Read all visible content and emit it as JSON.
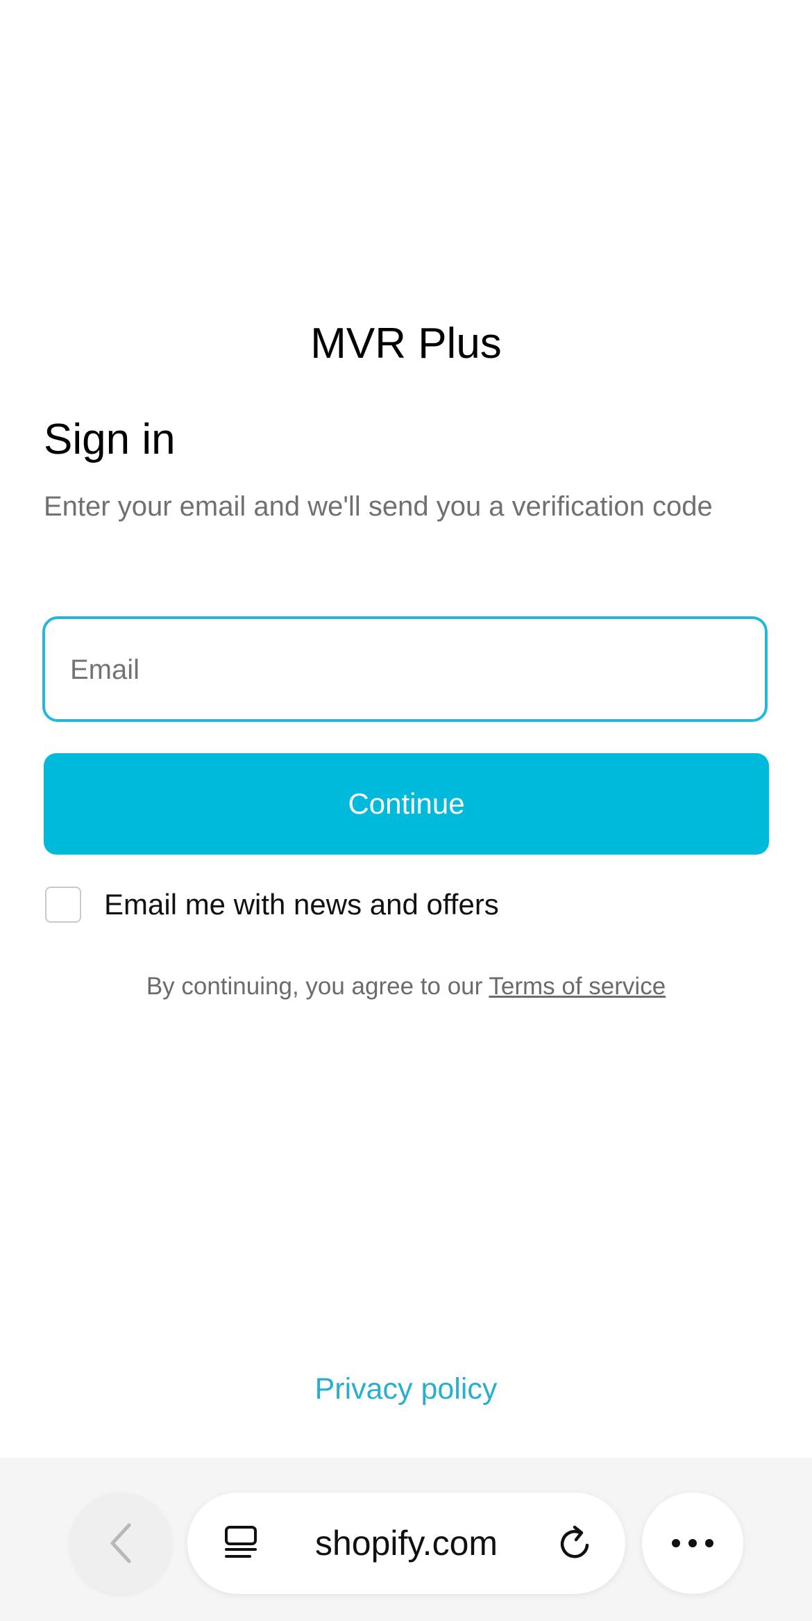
{
  "shop": {
    "name": "MVR Plus"
  },
  "signin": {
    "heading": "Sign in",
    "subtitle": "Enter your email and we'll send you a verification code",
    "email_placeholder": "Email",
    "email_value": "",
    "continue_label": "Continue",
    "newsletter_label": "Email me with news and offers",
    "newsletter_checked": false,
    "terms_prefix": "By continuing, you agree to our ",
    "terms_link": "Terms of service"
  },
  "footer": {
    "privacy_link": "Privacy policy"
  },
  "browser": {
    "url": "shopify.com",
    "icons": {
      "back": "chevron-left-icon",
      "tabs": "tabs-icon",
      "reload": "reload-icon",
      "more": "more-icon"
    }
  },
  "colors": {
    "accent": "#00badb",
    "focus_border": "#22b8d9",
    "link": "#2aaed0"
  }
}
